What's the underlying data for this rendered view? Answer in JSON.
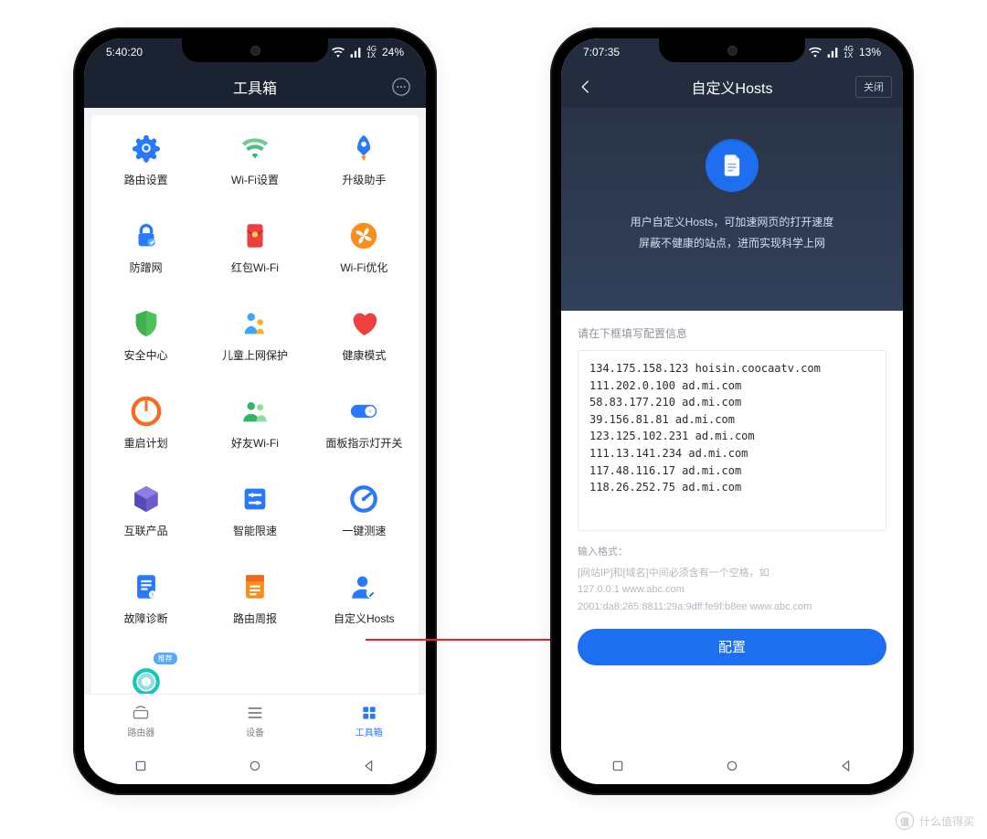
{
  "phone1": {
    "status": {
      "time": "5:40:20",
      "net": "4G",
      "battery": "24%"
    },
    "header": {
      "title": "工具箱"
    },
    "tools": [
      {
        "id": "router-settings",
        "label": "路由设置",
        "icon": "gear",
        "color": "#2879ff"
      },
      {
        "id": "wifi-settings",
        "label": "Wi-Fi设置",
        "icon": "wifi",
        "color": "#2fb566"
      },
      {
        "id": "upgrade-assist",
        "label": "升级助手",
        "icon": "rocket",
        "color": "#2879ff"
      },
      {
        "id": "anti-squat",
        "label": "防蹭网",
        "icon": "lock",
        "color": "#2879ff"
      },
      {
        "id": "redpacket-wifi",
        "label": "红包Wi-Fi",
        "icon": "redpack",
        "color": "#ef3f3f"
      },
      {
        "id": "wifi-optimize",
        "label": "Wi-Fi优化",
        "icon": "fan",
        "color": "#f98e1a"
      },
      {
        "id": "security-center",
        "label": "安全中心",
        "icon": "shield",
        "color": "#4ec15b"
      },
      {
        "id": "child-protect",
        "label": "儿童上网保护",
        "icon": "family",
        "color": "#3aa6ff"
      },
      {
        "id": "health-mode",
        "label": "健康模式",
        "icon": "heart",
        "color": "#ef3f3f"
      },
      {
        "id": "reboot-plan",
        "label": "重启计划",
        "icon": "power",
        "color": "#f86b1e"
      },
      {
        "id": "friends-wifi",
        "label": "好友Wi-Fi",
        "icon": "friends",
        "color": "#2fb566"
      },
      {
        "id": "panel-led",
        "label": "面板指示灯开关",
        "icon": "toggle",
        "color": "#2879ff"
      },
      {
        "id": "interlink",
        "label": "互联产品",
        "icon": "cube",
        "color": "#6d5bd0"
      },
      {
        "id": "smart-limit",
        "label": "智能限速",
        "icon": "sliders",
        "color": "#2879ff"
      },
      {
        "id": "speed-test",
        "label": "一键测速",
        "icon": "gauge",
        "color": "#2879ff"
      },
      {
        "id": "fault-diag",
        "label": "故障诊断",
        "icon": "docalert",
        "color": "#2879ff"
      },
      {
        "id": "router-weekly",
        "label": "路由周报",
        "icon": "report",
        "color": "#f98e1a"
      },
      {
        "id": "custom-hosts",
        "label": "自定义Hosts",
        "icon": "userpen",
        "color": "#2879ff"
      },
      {
        "id": "extra",
        "label": "",
        "icon": "ring",
        "color": "#18c5b8",
        "badge": "推荐"
      }
    ],
    "tabs": [
      {
        "id": "router",
        "label": "路由器"
      },
      {
        "id": "devices",
        "label": "设备"
      },
      {
        "id": "toolbox",
        "label": "工具箱",
        "active": true
      }
    ]
  },
  "phone2": {
    "status": {
      "time": "7:07:35",
      "net": "4G",
      "battery": "13%"
    },
    "header": {
      "title": "自定义Hosts",
      "close": "关闭"
    },
    "hero": {
      "line1": "用户自定义Hosts，可加速网页的打开速度",
      "line2": "屏蔽不健康的站点，进而实现科学上网"
    },
    "form": {
      "label": "请在下框填写配置信息",
      "value": "134.175.158.123 hoisin.coocaatv.com\n111.202.0.100 ad.mi.com\n58.83.177.210 ad.mi.com\n39.156.81.81 ad.mi.com\n123.125.102.231 ad.mi.com\n111.13.141.234 ad.mi.com\n117.48.116.17 ad.mi.com\n118.26.252.75 ad.mi.com",
      "hintTitle": "输入格式：",
      "hintLine": "[网站IP]和[域名]中间必须含有一个空格，如",
      "hintEx1": "127.0.0.1 www.abc.com",
      "hintEx2": "2001:da8:265:8811:29a:9dff:fe9f:b8ee www.abc.com",
      "submit": "配置"
    }
  },
  "watermark": "什么值得买"
}
